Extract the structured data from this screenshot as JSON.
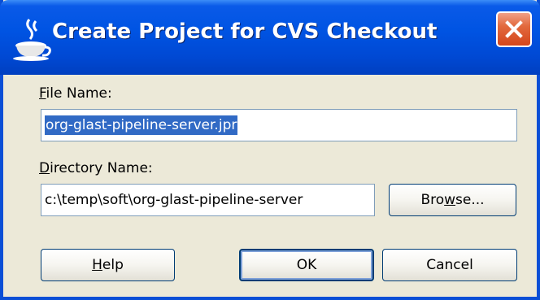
{
  "window": {
    "title": "Create Project for CVS Checkout",
    "app_icon": "java-cup-icon",
    "close_icon": "close-x-icon"
  },
  "form": {
    "file_name": {
      "label_mnemonic": "F",
      "label_rest": "ile Name:",
      "value": "org-glast-pipeline-server.jpr",
      "selected": true
    },
    "directory_name": {
      "label_mnemonic": "D",
      "label_rest": "irectory Name:",
      "value": "c:\\temp\\soft\\org-glast-pipeline-server"
    },
    "browse_button": {
      "label_before": "Bro",
      "label_mnemonic": "w",
      "label_after": "se..."
    }
  },
  "buttons": {
    "help": {
      "label_mnemonic": "H",
      "label_rest": "elp"
    },
    "ok": {
      "label": "OK",
      "is_default": true
    },
    "cancel": {
      "label": "Cancel"
    }
  },
  "colors": {
    "title_bar": "#0054e3",
    "close_button": "#d4461c",
    "dialog_face": "#ece9d8",
    "selection": "#316ac5",
    "input_border": "#7f9db9"
  }
}
